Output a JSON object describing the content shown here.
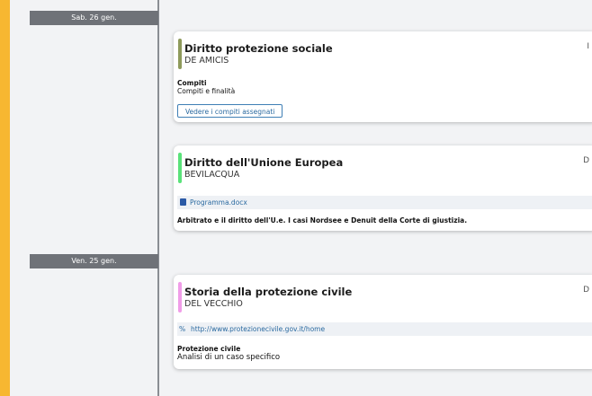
{
  "days": [
    {
      "label": "Sab. 26 gen."
    },
    {
      "label": "Ven. 25 gen."
    }
  ],
  "cards": [
    {
      "title": "Diritto protezione sociale",
      "teacher": "DE AMICIS",
      "side_letter": "I",
      "strip_color": "#8e9a5b",
      "section_title": "Compiti",
      "section_text": "Compiti e finalità",
      "button_label": "Vedere i compiti assegnati"
    },
    {
      "title": "Diritto dell'Unione Europea",
      "teacher": "BEVILACQUA",
      "side_letter": "D",
      "strip_color": "#5ae27a",
      "attachment": "Programma.docx",
      "attachment_icon": "word-document-icon",
      "description": "Arbitrato e il diritto dell'U.e. I casi Nordsee e Denuit della Corte di giustizia."
    },
    {
      "title": "Storia della protezione civile",
      "teacher": "DEL VECCHIO",
      "side_letter": "D",
      "strip_color": "#f09de8",
      "link": "http://www.protezionecivile.gov.it/home",
      "link_icon": "link-icon",
      "section_title": "Protezione civile",
      "section_text": "Analisi di un caso specifico"
    }
  ],
  "colors": {
    "accent": "#f7b731",
    "day_header_bg": "#6f7278",
    "link": "#2b6aa0"
  }
}
